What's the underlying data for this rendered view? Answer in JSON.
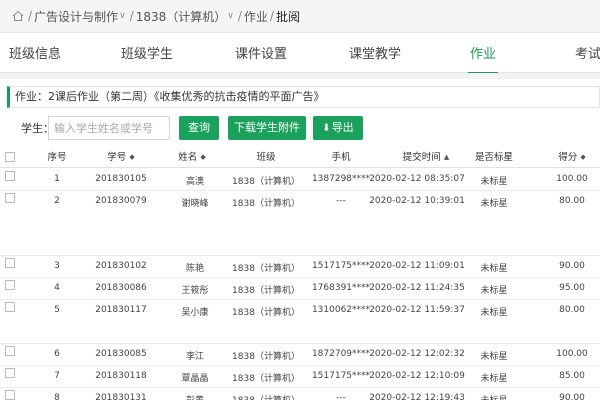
{
  "breadcrumb": {
    "items": [
      "广告设计与制作",
      "1838（计算机）",
      "作业"
    ],
    "current": "批阅",
    "separator": "/",
    "caret": "∨"
  },
  "tabs": [
    {
      "label": "班级信息",
      "active": false
    },
    {
      "label": "班级学生",
      "active": false
    },
    {
      "label": "课件设置",
      "active": false
    },
    {
      "label": "课堂教学",
      "active": false
    },
    {
      "label": "作业",
      "active": true
    },
    {
      "label": "考试",
      "active": false
    }
  ],
  "homework_title": "作业：2课后作业（第二周）《收集优秀的抗击疫情的平面广告》",
  "search": {
    "label": "学生：",
    "placeholder": "输入学生姓名或学号",
    "value": ""
  },
  "buttons": {
    "query": "查询",
    "download": "下载学生附件",
    "export": "导出"
  },
  "table": {
    "columns": [
      "序号",
      "学号",
      "姓名",
      "班级",
      "手机",
      "提交时间",
      "是否标星",
      "得分"
    ],
    "sortable": [
      false,
      true,
      true,
      false,
      false,
      true,
      false,
      true
    ],
    "sort_active": "提交时间",
    "rows": [
      {
        "no": "1",
        "id": "201830105",
        "name": "高澳",
        "class": "1838（计算机）",
        "phone": "1387298****",
        "time": "2020-02-12 08:35:07",
        "star": "未标星",
        "score": "100.00"
      },
      {
        "no": "2",
        "id": "201830079",
        "name": "谢晓峰",
        "class": "1838（计算机）",
        "phone": "---",
        "time": "2020-02-12 10:39:01",
        "star": "未标星",
        "score": "80.00"
      },
      {
        "no": "3",
        "id": "201830102",
        "name": "陈艳",
        "class": "1838（计算机）",
        "phone": "1517175****",
        "time": "2020-02-12 11:09:01",
        "star": "未标星",
        "score": "90.00"
      },
      {
        "no": "4",
        "id": "201830086",
        "name": "王筱彤",
        "class": "1838（计算机）",
        "phone": "1768391****",
        "time": "2020-02-12 11:24:35",
        "star": "未标星",
        "score": "95.00"
      },
      {
        "no": "5",
        "id": "201830117",
        "name": "吴小康",
        "class": "1838（计算机）",
        "phone": "1310062****",
        "time": "2020-02-12 11:59:37",
        "star": "未标星",
        "score": "80.00"
      },
      {
        "no": "6",
        "id": "201830085",
        "name": "李江",
        "class": "1838（计算机）",
        "phone": "1872709****",
        "time": "2020-02-12 12:02:32",
        "star": "未标星",
        "score": "100.00"
      },
      {
        "no": "7",
        "id": "201830118",
        "name": "覃晶晶",
        "class": "1838（计算机）",
        "phone": "1517175****",
        "time": "2020-02-12 12:10:09",
        "star": "未标星",
        "score": "85.00"
      },
      {
        "no": "8",
        "id": "201830131",
        "name": "彭黄",
        "class": "1838（计算机）",
        "phone": "---",
        "time": "2020-02-12 12:19:43",
        "star": "未标星",
        "score": "90.00"
      }
    ]
  },
  "colors": {
    "accent": "#1b9a55",
    "button": "#1aa25c"
  },
  "icons": {
    "home": "home-icon",
    "sort": "sort-icon",
    "download": "download-icon"
  }
}
